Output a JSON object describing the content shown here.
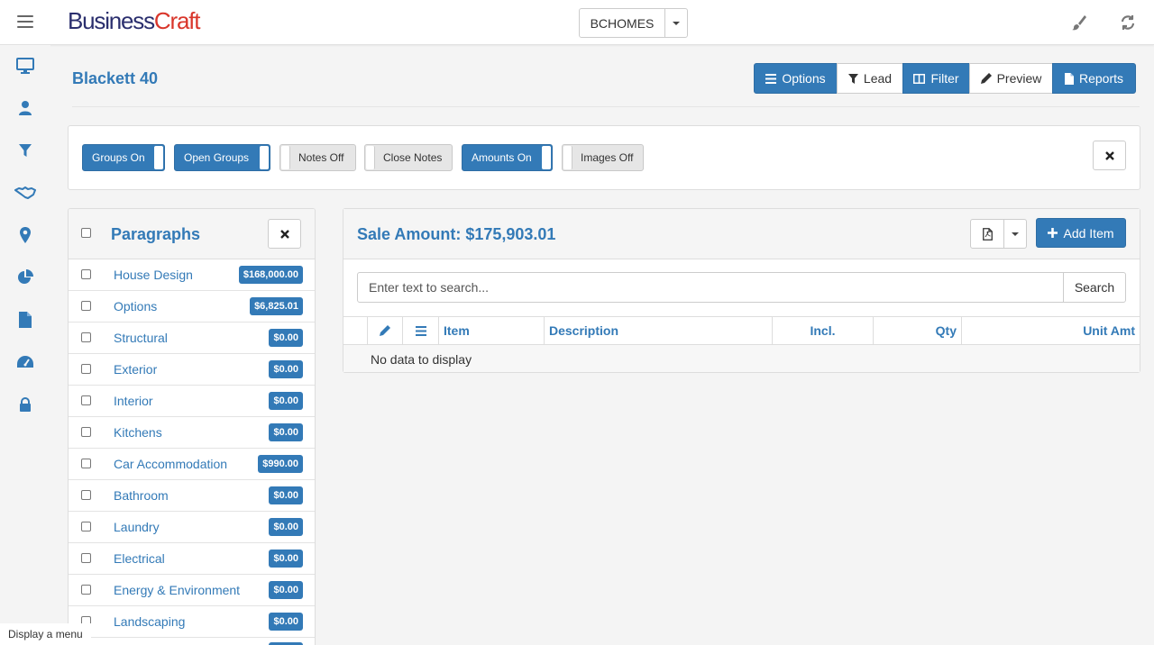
{
  "app": {
    "logo_part1": "Business",
    "logo_part2": "Craft",
    "company": "BCHOMES"
  },
  "sidebar": {
    "items": [
      {
        "icon": "monitor-icon"
      },
      {
        "icon": "user-icon"
      },
      {
        "icon": "filter-icon"
      },
      {
        "icon": "handshake-icon"
      },
      {
        "icon": "map-marker-icon"
      },
      {
        "icon": "pie-chart-icon"
      },
      {
        "icon": "document-icon"
      },
      {
        "icon": "dashboard-icon"
      },
      {
        "icon": "lock-icon"
      }
    ]
  },
  "header": {
    "title": "Blackett 40",
    "buttons": {
      "options": "Options",
      "lead": "Lead",
      "filter": "Filter",
      "preview": "Preview",
      "reports": "Reports"
    }
  },
  "toggles": {
    "groups": "Groups On",
    "open_groups": "Open Groups",
    "notes": "Notes Off",
    "close_notes": "Close Notes",
    "amounts": "Amounts On",
    "images": "Images Off"
  },
  "paragraphs": {
    "title": "Paragraphs",
    "items": [
      {
        "name": "House Design",
        "amount": "$168,000.00"
      },
      {
        "name": "Options",
        "amount": "$6,825.01"
      },
      {
        "name": "Structural",
        "amount": "$0.00"
      },
      {
        "name": "Exterior",
        "amount": "$0.00"
      },
      {
        "name": "Interior",
        "amount": "$0.00"
      },
      {
        "name": "Kitchens",
        "amount": "$0.00"
      },
      {
        "name": "Car Accommodation",
        "amount": "$990.00"
      },
      {
        "name": "Bathroom",
        "amount": "$0.00"
      },
      {
        "name": "Laundry",
        "amount": "$0.00"
      },
      {
        "name": "Electrical",
        "amount": "$0.00"
      },
      {
        "name": "Energy & Environment",
        "amount": "$0.00"
      },
      {
        "name": "Landscaping",
        "amount": "$0.00"
      }
    ]
  },
  "items_panel": {
    "title": "Sale Amount: $175,903.01",
    "add_label": "Add Item",
    "search_placeholder": "Enter text to search...",
    "search_label": "Search",
    "columns": {
      "item": "Item",
      "description": "Description",
      "incl": "Incl.",
      "qty": "Qty",
      "unit_amt": "Unit Amt"
    },
    "empty": "No data to display"
  },
  "tooltip": "Display a menu",
  "colors": {
    "primary": "#337ab7",
    "logo_dark": "#2b2f6e",
    "logo_red": "#d9362b"
  }
}
